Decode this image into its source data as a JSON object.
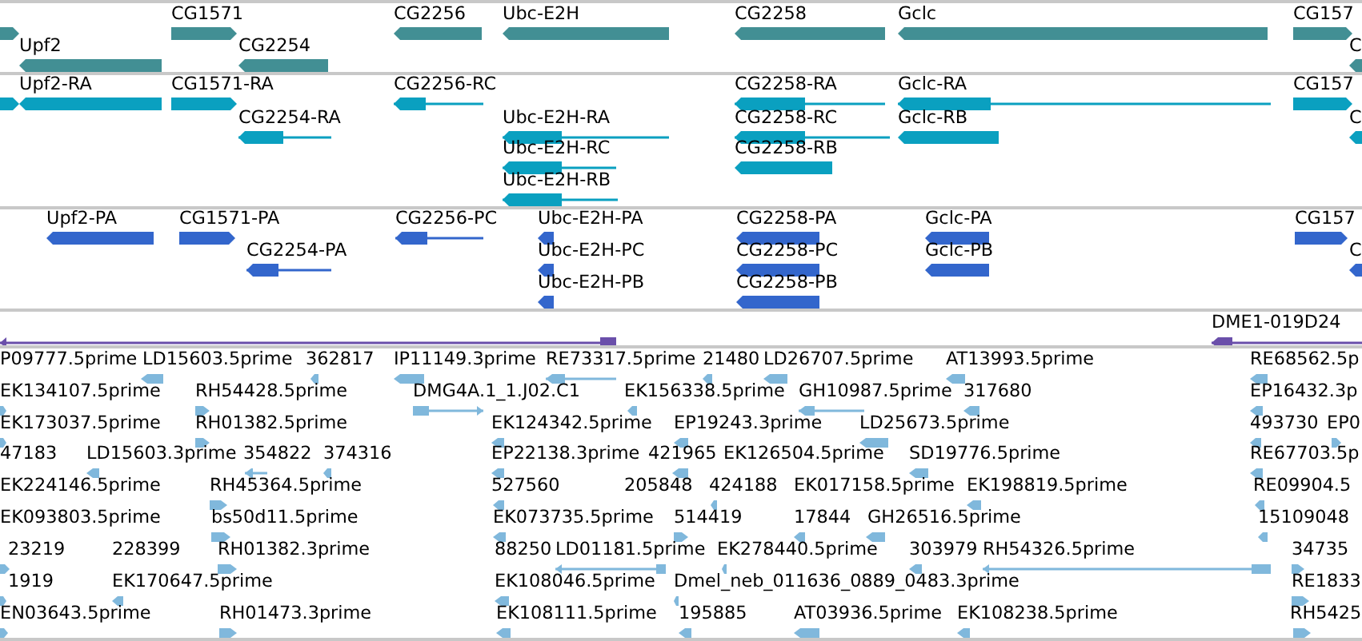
{
  "tracks": [
    {
      "kind": "gene",
      "features": [
        {
          "kind": "forward"
        },
        {
          "label": "CG1571",
          "kind": "forward"
        },
        {
          "label": "CG2256",
          "kind": "reverse"
        },
        {
          "label": "Ubc-E2H",
          "kind": "reverse"
        },
        {
          "label": "CG2258",
          "kind": "reverse"
        },
        {
          "label": "Gclc",
          "kind": "reverse"
        },
        {
          "label": "CG157",
          "kind": "forward"
        },
        {
          "label": "Upf2",
          "kind": "reverse"
        },
        {
          "label": "CG2254",
          "kind": "reverse"
        },
        {
          "label": "C",
          "kind": "reverse"
        }
      ]
    },
    {
      "kind": "transcript",
      "features": [
        {
          "kind": "forward"
        },
        {
          "label": "Upf2-RA",
          "kind": "reverse"
        },
        {
          "label": "CG1571-RA",
          "kind": "forward"
        },
        {
          "label": "CG2256-RC",
          "kind": "reverse"
        },
        {
          "label": "CG2258-RA",
          "kind": "reverse"
        },
        {
          "label": "Gclc-RA",
          "kind": "reverse"
        },
        {
          "label": "CG157",
          "kind": "forward"
        },
        {
          "label": "CG2254-RA",
          "kind": "reverse"
        },
        {
          "label": "Ubc-E2H-RA",
          "kind": "reverse"
        },
        {
          "label": "CG2258-RC",
          "kind": "reverse"
        },
        {
          "label": "Gclc-RB",
          "kind": "reverse"
        },
        {
          "label": "C",
          "kind": "reverse"
        },
        {
          "label": "Ubc-E2H-RC",
          "kind": "reverse"
        },
        {
          "label": "CG2258-RB",
          "kind": "reverse"
        },
        {
          "label": "Ubc-E2H-RB",
          "kind": "reverse"
        }
      ]
    },
    {
      "kind": "protein",
      "features": [
        {
          "label": "Upf2-PA",
          "kind": "reverse"
        },
        {
          "label": "CG1571-PA",
          "kind": "forward"
        },
        {
          "label": "CG2256-PC",
          "kind": "reverse"
        },
        {
          "label": "Ubc-E2H-PA",
          "kind": "reverse"
        },
        {
          "label": "CG2258-PA",
          "kind": "reverse"
        },
        {
          "label": "Gclc-PA",
          "kind": "reverse"
        },
        {
          "label": "CG157",
          "kind": "forward"
        },
        {
          "label": "CG2254-PA",
          "kind": "reverse"
        },
        {
          "label": "Ubc-E2H-PC",
          "kind": "reverse"
        },
        {
          "label": "CG2258-PC",
          "kind": "reverse"
        },
        {
          "label": "Gclc-PB",
          "kind": "reverse"
        },
        {
          "label": "C",
          "kind": "reverse"
        },
        {
          "label": "Ubc-E2H-PB",
          "kind": "reverse"
        },
        {
          "label": "CG2258-PB",
          "kind": "reverse"
        }
      ]
    },
    {
      "kind": "clone",
      "features": [
        {
          "kind": "reverse"
        },
        {
          "label": "DME1-019D24",
          "kind": "reverse"
        }
      ]
    },
    {
      "kind": "est",
      "features": [
        {
          "label": "P09777.5prime",
          "kind": "label"
        },
        {
          "label": "LD15603.5prime",
          "kind": "reverse"
        },
        {
          "label": "362817",
          "kind": "reverse"
        },
        {
          "label": "IP11149.3prime",
          "kind": "reverse"
        },
        {
          "label": "RE73317.5prime",
          "kind": "reverse"
        },
        {
          "label": "21480",
          "kind": "reverse"
        },
        {
          "label": "LD26707.5prime",
          "kind": "reverse"
        },
        {
          "label": "AT13993.5prime",
          "kind": "reverse"
        },
        {
          "label": "RE68562.5p",
          "kind": "reverse"
        },
        {
          "label": "EK134107.5prime",
          "kind": "forward"
        },
        {
          "label": "RH54428.5prime",
          "kind": "forward"
        },
        {
          "label": "DMG4A.1_1.J02.C1",
          "kind": "forward"
        },
        {
          "label": "EK156338.5prime",
          "kind": "reverse"
        },
        {
          "label": "GH10987.5prime",
          "kind": "reverse"
        },
        {
          "label": "317680",
          "kind": "reverse"
        },
        {
          "label": "EP16432.3p",
          "kind": "reverse"
        },
        {
          "label": "EK173037.5prime",
          "kind": "forward"
        },
        {
          "label": "RH01382.5prime",
          "kind": "forward"
        },
        {
          "label": "EK124342.5prime",
          "kind": "reverse"
        },
        {
          "label": "EP19243.3prime",
          "kind": "reverse"
        },
        {
          "label": "LD25673.5prime",
          "kind": "reverse"
        },
        {
          "label": "493730",
          "kind": "reverse"
        },
        {
          "label": "EP0",
          "kind": "forward"
        },
        {
          "label": "47183",
          "kind": "label"
        },
        {
          "label": "LD15603.3prime",
          "kind": "reverse"
        },
        {
          "label": "354822",
          "kind": "reverse"
        },
        {
          "label": "374316",
          "kind": "reverse"
        },
        {
          "label": "EP22138.3prime",
          "kind": "reverse"
        },
        {
          "label": "421965",
          "kind": "reverse"
        },
        {
          "label": "EK126504.5prime",
          "kind": "label"
        },
        {
          "label": "SD19776.5prime",
          "kind": "reverse"
        },
        {
          "label": "RE67703.5p",
          "kind": "reverse"
        },
        {
          "label": "EK224146.5prime",
          "kind": "label"
        },
        {
          "label": "RH45364.5prime",
          "kind": "forward"
        },
        {
          "label": "527560",
          "kind": "reverse"
        },
        {
          "label": "205848",
          "kind": "label"
        },
        {
          "label": "424188",
          "kind": "reverse"
        },
        {
          "label": "EK017158.5prime",
          "kind": "label"
        },
        {
          "label": "EK198819.5prime",
          "kind": "reverse"
        },
        {
          "label": "RE09904.5",
          "kind": "reverse"
        },
        {
          "label": "EK093803.5prime",
          "kind": "label"
        },
        {
          "label": "bs50d11.5prime",
          "kind": "forward"
        },
        {
          "label": "EK073735.5prime",
          "kind": "reverse"
        },
        {
          "label": "514419",
          "kind": "forward"
        },
        {
          "label": "17844",
          "kind": "reverse"
        },
        {
          "label": "GH26516.5prime",
          "kind": "reverse"
        },
        {
          "label": "15109048",
          "kind": "reverse"
        },
        {
          "label": "23219",
          "kind": "forward"
        },
        {
          "label": "228399",
          "kind": "label"
        },
        {
          "label": "RH01382.3prime",
          "kind": "forward"
        },
        {
          "label": "88250",
          "kind": "label"
        },
        {
          "label": "LD01181.5prime",
          "kind": "reverse"
        },
        {
          "label": "EK278440.5prime",
          "kind": "reverse"
        },
        {
          "label": "303979",
          "kind": "reverse"
        },
        {
          "label": "RH54326.5prime",
          "kind": "reverse"
        },
        {
          "label": "34735",
          "kind": "forward"
        },
        {
          "label": "1919",
          "kind": "forward"
        },
        {
          "label": "EK170647.5prime",
          "kind": "reverse"
        },
        {
          "label": "EK108046.5prime",
          "kind": "reverse"
        },
        {
          "label": "Dmel_neb_011636_0889_0483.3prime",
          "kind": "reverse"
        },
        {
          "label": "RE1833",
          "kind": "forward"
        },
        {
          "label": "EN03643.5prime",
          "kind": "forward"
        },
        {
          "label": "RH01473.3prime",
          "kind": "forward"
        },
        {
          "label": "EK108111.5prime",
          "kind": "reverse"
        },
        {
          "label": "195885",
          "kind": "reverse"
        },
        {
          "label": "AT03936.5prime",
          "kind": "reverse"
        },
        {
          "label": "EK108238.5prime",
          "kind": "reverse"
        },
        {
          "label": "RH5425",
          "kind": "forward"
        }
      ]
    }
  ]
}
